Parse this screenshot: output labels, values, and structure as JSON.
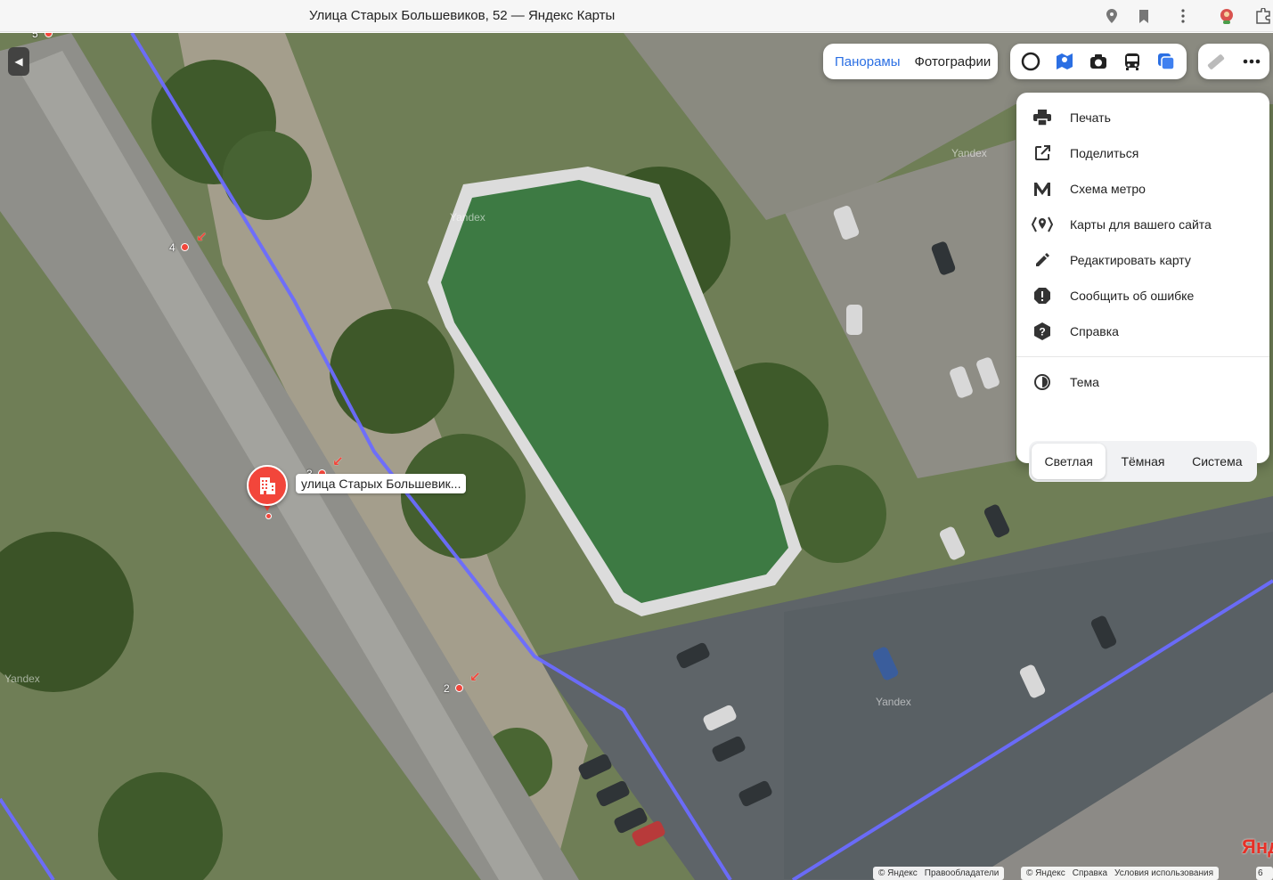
{
  "window": {
    "title": "Улица Старых Большевиков, 52 — Яндекс Карты"
  },
  "map_controls": {
    "pano_tabs": [
      "Панорамы",
      "Фотографии"
    ],
    "active_pano_tab": "Панорамы",
    "layers": [
      "traffic-icon",
      "map-layers-icon",
      "panorama-camera-icon",
      "transit-bus-icon",
      "satellite-layers-icon"
    ],
    "tools": [
      "ruler-icon",
      "more-icon"
    ]
  },
  "menu": {
    "items": [
      {
        "label": "Печать",
        "icon": "printer-icon"
      },
      {
        "label": "Поделиться",
        "icon": "share-icon"
      },
      {
        "label": "Схема метро",
        "icon": "metro-icon"
      },
      {
        "label": "Карты для вашего сайта",
        "icon": "map-embed-icon"
      },
      {
        "label": "Редактировать карту",
        "icon": "pencil-icon"
      },
      {
        "label": "Сообщить об ошибке",
        "icon": "report-error-icon"
      },
      {
        "label": "Справка",
        "icon": "help-icon"
      }
    ],
    "theme": {
      "label": "Тема",
      "options": [
        "Светлая",
        "Тёмная",
        "Система"
      ],
      "selected": "Светлая"
    }
  },
  "place": {
    "label": "улица Старых Большевик..."
  },
  "entrances": [
    "5",
    "4",
    "3",
    "2"
  ],
  "watermark": "Yandex",
  "footer": {
    "left": [
      "© Яндекс",
      "Правообладатели"
    ],
    "right": [
      "© Яндекс",
      "Справка",
      "Условия использования"
    ],
    "scale_text": "6",
    "logo": "Янд"
  },
  "colors": {
    "accent": "#2b6fe3",
    "marker": "#f2463b",
    "route_line": "#6b6bff"
  }
}
